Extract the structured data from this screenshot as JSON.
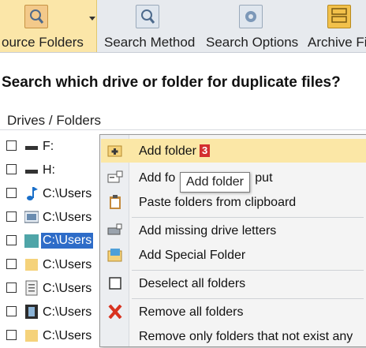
{
  "toolbar": {
    "buttons": [
      {
        "label": "ource Folders",
        "icon": "magnifier-folder-icon",
        "active": true
      },
      {
        "label": "Search Method",
        "icon": "magnifier-icon"
      },
      {
        "label": "Search Options",
        "icon": "gear-icon"
      },
      {
        "label": "Archive Fi",
        "icon": "archive-cabinet-icon"
      }
    ]
  },
  "main": {
    "title": "Search which drive or folder for duplicate files?",
    "column_header": "Drives / Folders",
    "rows": [
      {
        "label": "F:",
        "icon": "drive-icon"
      },
      {
        "label": "H:",
        "icon": "drive-icon"
      },
      {
        "label": "C:\\Users",
        "icon": "music-note-icon"
      },
      {
        "label": "C:\\Users",
        "icon": "picture-folder-icon"
      },
      {
        "label": "C:\\Users",
        "icon": "teal-folder-icon",
        "selected": true
      },
      {
        "label": "C:\\Users",
        "icon": "folder-icon"
      },
      {
        "label": "C:\\Users",
        "icon": "document-icon"
      },
      {
        "label": "C:\\Users",
        "icon": "film-icon"
      },
      {
        "label": "C:\\Users",
        "icon": "folder-icon"
      }
    ]
  },
  "context_menu": {
    "items": [
      {
        "label": "Add folder",
        "badge": "3",
        "icon": "add-folder-icon"
      },
      {
        "label": "Add fo",
        "label_tail": "put",
        "icon": "add-input-icon"
      },
      {
        "label": "Paste folders from clipboard",
        "icon": "clipboard-icon"
      },
      {
        "label": "Add missing drive letters",
        "icon": "drive-add-icon"
      },
      {
        "label": "Add Special Folder",
        "icon": "special-folder-icon"
      },
      {
        "label": "Deselect all folders",
        "icon": "checkbox-icon"
      },
      {
        "label": "Remove all folders",
        "icon": "red-x-icon"
      },
      {
        "label": "Remove only folders that not exist any",
        "icon": "none"
      }
    ]
  },
  "tooltip": {
    "text": "Add folder"
  },
  "colors": {
    "highlight": "#fbe7a6",
    "selection": "#2e6cc8",
    "badge": "#d32f2f"
  }
}
